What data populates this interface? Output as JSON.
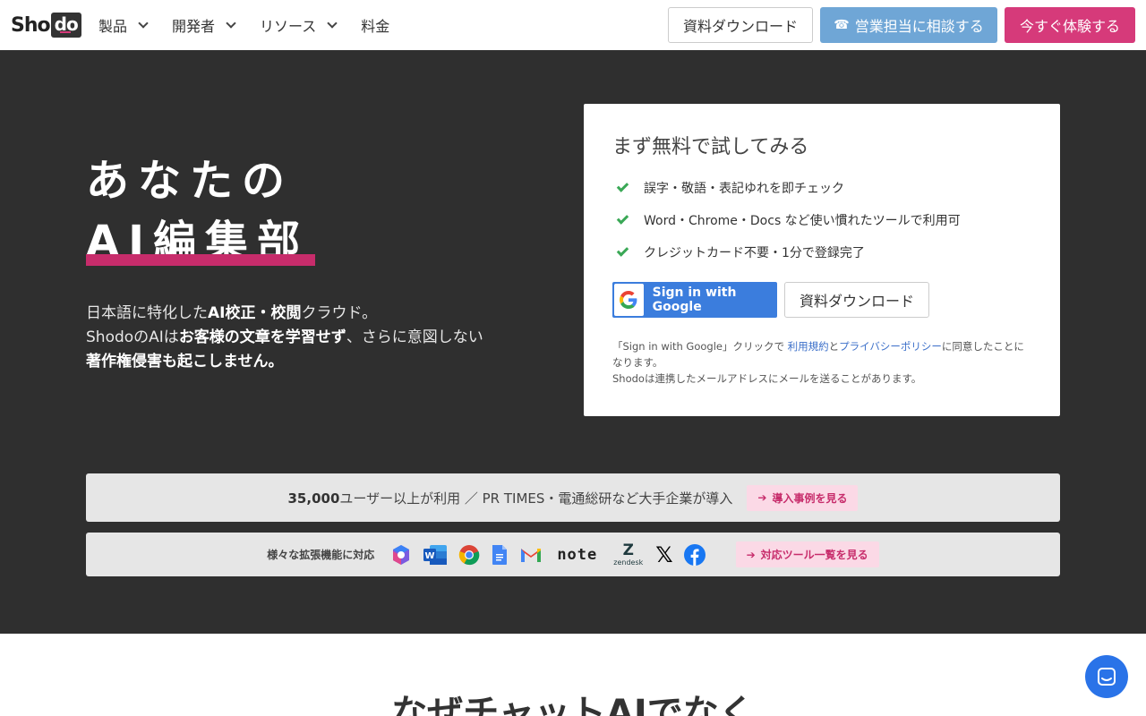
{
  "nav": {
    "logo_prefix": "Sho",
    "logo_box": "do",
    "menu": [
      {
        "label": "製品",
        "has_dropdown": true
      },
      {
        "label": "開発者",
        "has_dropdown": true
      },
      {
        "label": "リソース",
        "has_dropdown": true
      },
      {
        "label": "料金",
        "has_dropdown": false
      }
    ],
    "download_label": "資料ダウンロード",
    "sales_label": "営業担当に相談する",
    "try_label": "今すぐ体験する"
  },
  "hero": {
    "title_line1": "あなたの",
    "title_line2": "AI編集部",
    "copy_line1_a": "日本語に特化した",
    "copy_line1_b": "AI校正・校閲",
    "copy_line1_c": "クラウド。",
    "copy_line2_a": "ShodoのAIは",
    "copy_line2_b": "お客様の文章を学習せず",
    "copy_line2_c": "、さらに意図しない",
    "copy_line3": "著作権侵害も起こしません。"
  },
  "card": {
    "title": "まず無料で試してみる",
    "checks": [
      "誤字・敬語・表記ゆれを即チェック",
      "Word・Chrome・Docs など使い慣れたツールで利用可",
      "クレジットカード不要・1分で登録完了"
    ],
    "google_label": "Sign in with Google",
    "download_label": "資料ダウンロード",
    "note_a": "「Sign in with Google」クリックで ",
    "note_terms": "利用規約",
    "note_and": "と",
    "note_privacy": "プライバシーポリシー",
    "note_b": "に同意したことになります。",
    "note_c": "Shodoは連携したメールアドレスにメールを送ることがあります。"
  },
  "stats": {
    "count": "35,000",
    "text": "ユーザー以上が利用 ／ PR TIMES・電通総研など大手企業が導入",
    "link": "導入事例を見る"
  },
  "tools": {
    "label": "様々な拡張機能に対応",
    "items": [
      "copilot-icon",
      "word-icon",
      "chrome-icon",
      "docs-icon",
      "gmail-icon",
      "note-logo",
      "zendesk-logo",
      "x-logo",
      "facebook-icon"
    ],
    "note_text": "note",
    "zendesk_text": "zendesk",
    "link": "対応ツール一覧を見る"
  },
  "bottom": {
    "title": "なぜチャットAIでなく"
  },
  "colors": {
    "accent_pink": "#d63a7a",
    "sales_blue": "#6fa6d6",
    "hero_bg": "#2f2f2f",
    "check_green": "#3aa856"
  }
}
